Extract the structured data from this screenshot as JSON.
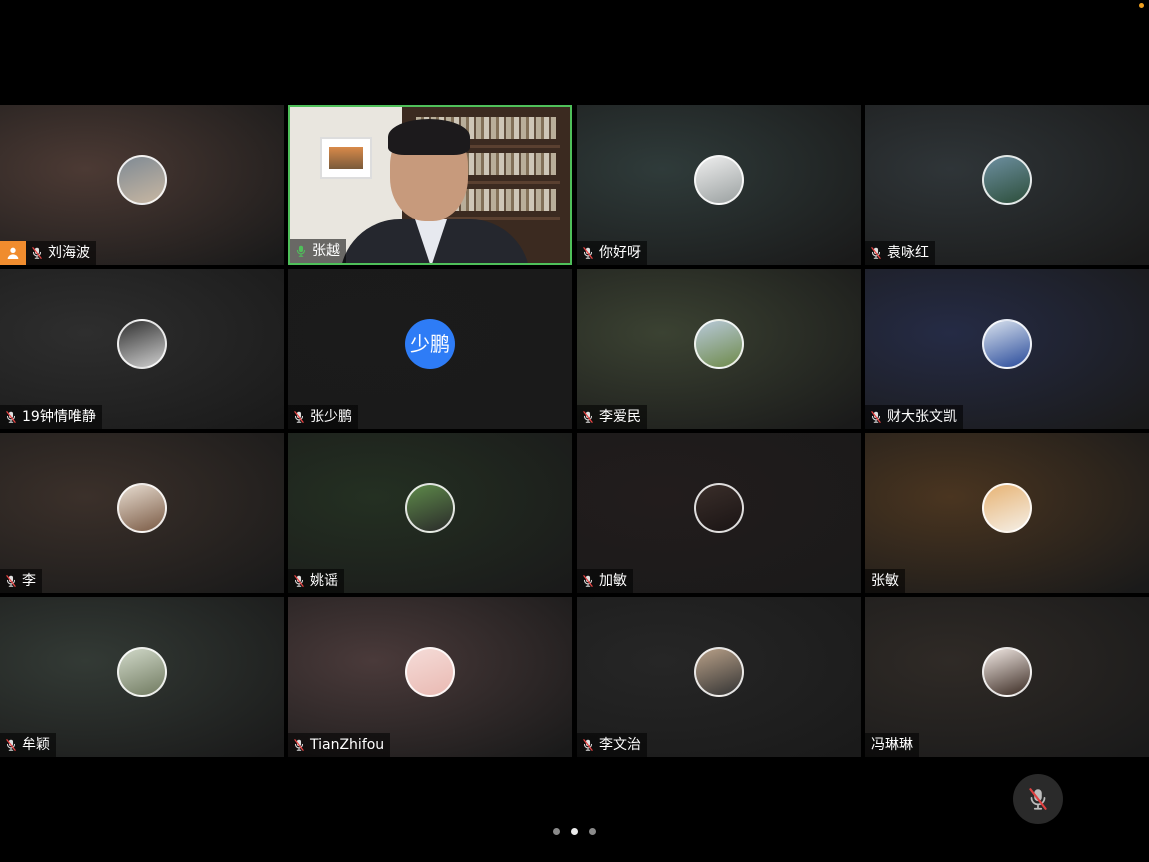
{
  "participants": [
    {
      "name": "刘海波",
      "muted": true,
      "host": true,
      "bg": "#4c3a34",
      "avatar": [
        "#7f8a94",
        "#c8b7a2"
      ]
    },
    {
      "name": "张越",
      "muted": false,
      "active": true,
      "video": true
    },
    {
      "name": "你好呀",
      "muted": true,
      "bg": "#2f3b3a",
      "avatar": [
        "#eeeeee",
        "#9aa0a0"
      ]
    },
    {
      "name": "袁咏红",
      "muted": true,
      "bg": "#2f3538",
      "avatar": [
        "#6d8fa0",
        "#2c4e3a"
      ]
    },
    {
      "name": "19钟情唯静",
      "muted": true,
      "bg": "#2e2e2e",
      "avatar": [
        "#303030",
        "#cfcfcf"
      ]
    },
    {
      "name": "张少鹏",
      "muted": true,
      "bg": "#1b1b1b",
      "avatar_text": "少鹏"
    },
    {
      "name": "李爱民",
      "muted": true,
      "bg": "#3b4232",
      "avatar": [
        "#b8c9d9",
        "#6e8a4a"
      ]
    },
    {
      "name": "财大张文凯",
      "muted": true,
      "bg": "#252b45",
      "avatar": [
        "#d9e2ee",
        "#284a9a"
      ]
    },
    {
      "name": "李",
      "muted": true,
      "bg": "#3b302a",
      "avatar": [
        "#e7dcd0",
        "#7a5a44"
      ]
    },
    {
      "name": "姚谣",
      "muted": true,
      "bg": "#243022",
      "avatar": [
        "#5e8a4a",
        "#2a2a2a"
      ]
    },
    {
      "name": "加敏",
      "muted": true,
      "bg": "#221c1c",
      "avatar": [
        "#3a2e2a",
        "#1a1414"
      ]
    },
    {
      "name": "张敏",
      "muted": false,
      "no_mic": true,
      "bg": "#4a3520",
      "avatar": [
        "#e7b374",
        "#f5efe6"
      ]
    },
    {
      "name": "牟颖",
      "muted": true,
      "bg": "#333a35",
      "avatar": [
        "#d0d8c8",
        "#707a60"
      ]
    },
    {
      "name": "TianZhifou",
      "muted": true,
      "bg": "#4a3a3a",
      "avatar": [
        "#f5dcd8",
        "#e9b9b2"
      ]
    },
    {
      "name": "李文治",
      "muted": true,
      "bg": "#262626",
      "avatar": [
        "#b8a088",
        "#333333"
      ]
    },
    {
      "name": "冯琳琳",
      "muted": false,
      "no_mic": true,
      "bg": "#2f2a26",
      "avatar": [
        "#f2e9e4",
        "#3a2a22"
      ]
    }
  ],
  "pager": {
    "pages": 3,
    "current": 1
  },
  "colors": {
    "active_border": "#4fc05a",
    "host_badge": "#f08c2e",
    "avatar_text_bg": "#2e7cf6",
    "mic_on": "#4fc05a"
  },
  "icons": {
    "muted": "mic-off-icon",
    "unmuted": "mic-on-icon",
    "host": "person-icon",
    "mute_all": "mic-off-icon"
  }
}
